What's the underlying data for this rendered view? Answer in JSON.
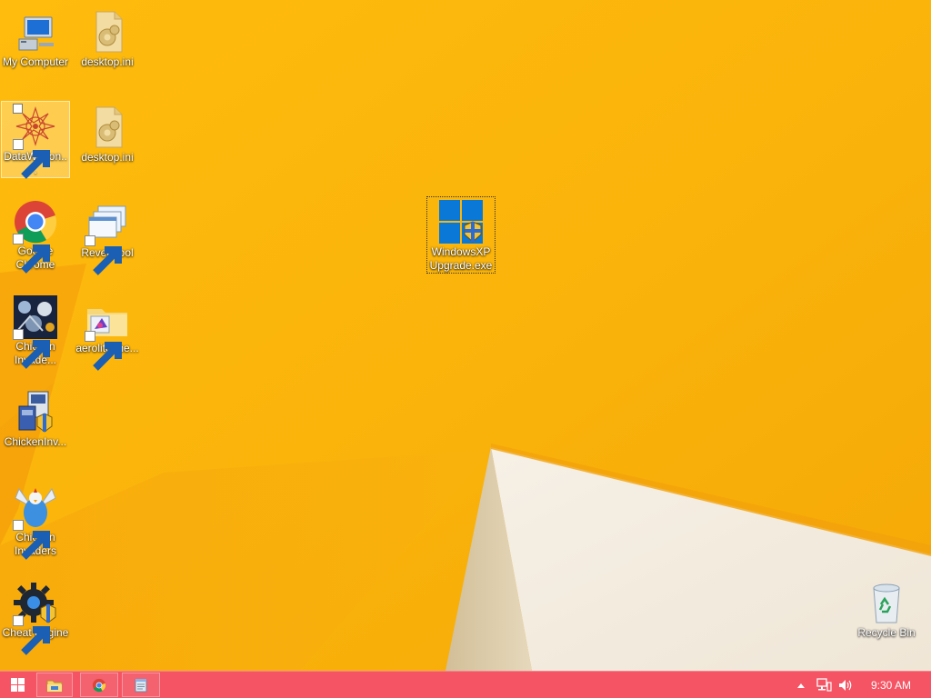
{
  "desktop": {
    "icons": [
      {
        "name": "My Computer",
        "icon": "computer-icon"
      },
      {
        "name": "desktop.ini",
        "icon": "settings-file-icon"
      },
      {
        "name": "DataWagon...",
        "icon": "datawagon-icon"
      },
      {
        "name": "desktop.ini",
        "icon": "settings-file-icon"
      },
      {
        "name": "Google\nChrome",
        "icon": "chrome-icon"
      },
      {
        "name": "Revert lool",
        "icon": "revert-tool-icon"
      },
      {
        "name": "Chicken\nInvade...",
        "icon": "chicken-invaders-icon"
      },
      {
        "name": "aerolite.the...",
        "icon": "theme-file-icon"
      },
      {
        "name": "ChickenInv...",
        "icon": "installer-icon"
      },
      {
        "name": "Chicken\nInvaders",
        "icon": "chicken-icon"
      },
      {
        "name": "Cheat Engine",
        "icon": "cheat-engine-icon"
      },
      {
        "name": "WindowsXP\nUpgrade.exe",
        "icon": "windows-upgrade-icon"
      },
      {
        "name": "Recycle Bin",
        "icon": "recycle-bin-icon"
      }
    ]
  },
  "taskbar": {
    "start": {
      "icon": "windows-start-icon"
    },
    "pinned": [
      {
        "icon": "file-explorer-icon"
      },
      {
        "icon": "chrome-icon"
      },
      {
        "icon": "notepad-icon"
      }
    ],
    "tray": {
      "show_hidden": {
        "icon": "chevron-up-icon"
      },
      "network": {
        "icon": "network-icon"
      },
      "volume": {
        "icon": "speaker-icon"
      },
      "time": "9:30 AM"
    }
  },
  "colors": {
    "wallpaper": "#f9b40a",
    "taskbar": "#f45463",
    "windows_blue": "#0a78d7"
  }
}
